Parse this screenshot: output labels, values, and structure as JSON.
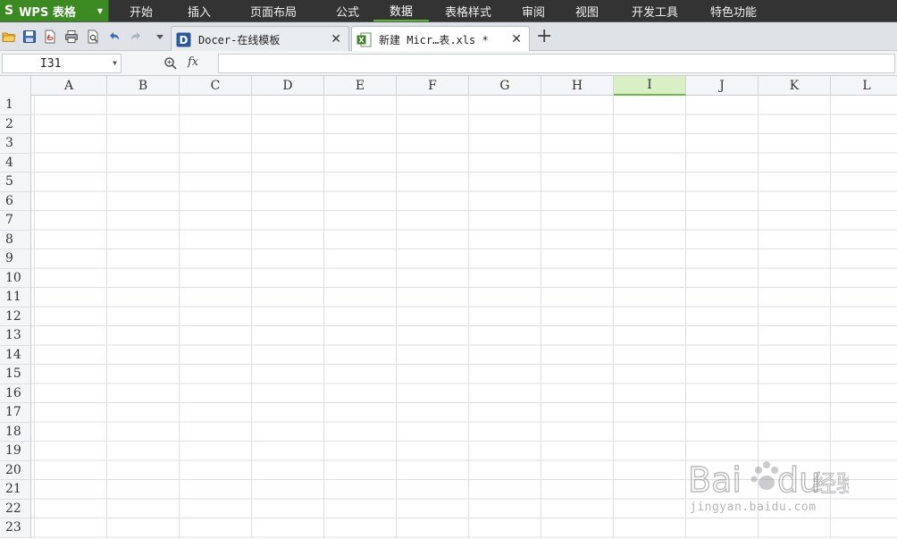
{
  "app": {
    "logo_letter": "S",
    "name": "WPS 表格",
    "brand_color": "#3c8a22"
  },
  "menu": [
    {
      "label": "开始",
      "active": false
    },
    {
      "label": "插入",
      "active": false
    },
    {
      "label": "页面布局",
      "active": false
    },
    {
      "label": "公式",
      "active": false
    },
    {
      "label": "数据",
      "active": true
    },
    {
      "label": "表格样式",
      "active": false
    },
    {
      "label": "审阅",
      "active": false
    },
    {
      "label": "视图",
      "active": false
    },
    {
      "label": "开发工具",
      "active": false
    },
    {
      "label": "特色功能",
      "active": false
    }
  ],
  "quick_access_icons": [
    "open-folder-icon",
    "save-icon",
    "export-pdf-icon",
    "print-icon",
    "print-preview-icon",
    "undo-icon",
    "redo-icon",
    "customize-dropdown-icon"
  ],
  "tabs": [
    {
      "label": "Docer-在线模板",
      "icon": "docer-icon",
      "active": false
    },
    {
      "label": "新建 Micr…表.xls *",
      "icon": "excel-file-icon",
      "active": true
    }
  ],
  "new_tab_label": "+",
  "formula_bar": {
    "name_box": "I31",
    "fx_label": "fx",
    "formula": ""
  },
  "columns": [
    "A",
    "B",
    "C",
    "D",
    "E",
    "F",
    "G",
    "H",
    "I",
    "J",
    "K",
    "L"
  ],
  "selected_column": "I",
  "rows": [
    "1",
    "2",
    "3",
    "4",
    "5",
    "6",
    "7",
    "8",
    "9",
    "10",
    "11",
    "12",
    "13",
    "14",
    "15",
    "16",
    "17",
    "18",
    "19",
    "20",
    "21",
    "22",
    "23"
  ],
  "watermark": {
    "text": "Bai du 经验",
    "url": "jingyan.baidu.com"
  },
  "colors": {
    "menubar": "#333333",
    "accent_green": "#5ab535",
    "selected_col_bg": "#d9f0c6"
  }
}
